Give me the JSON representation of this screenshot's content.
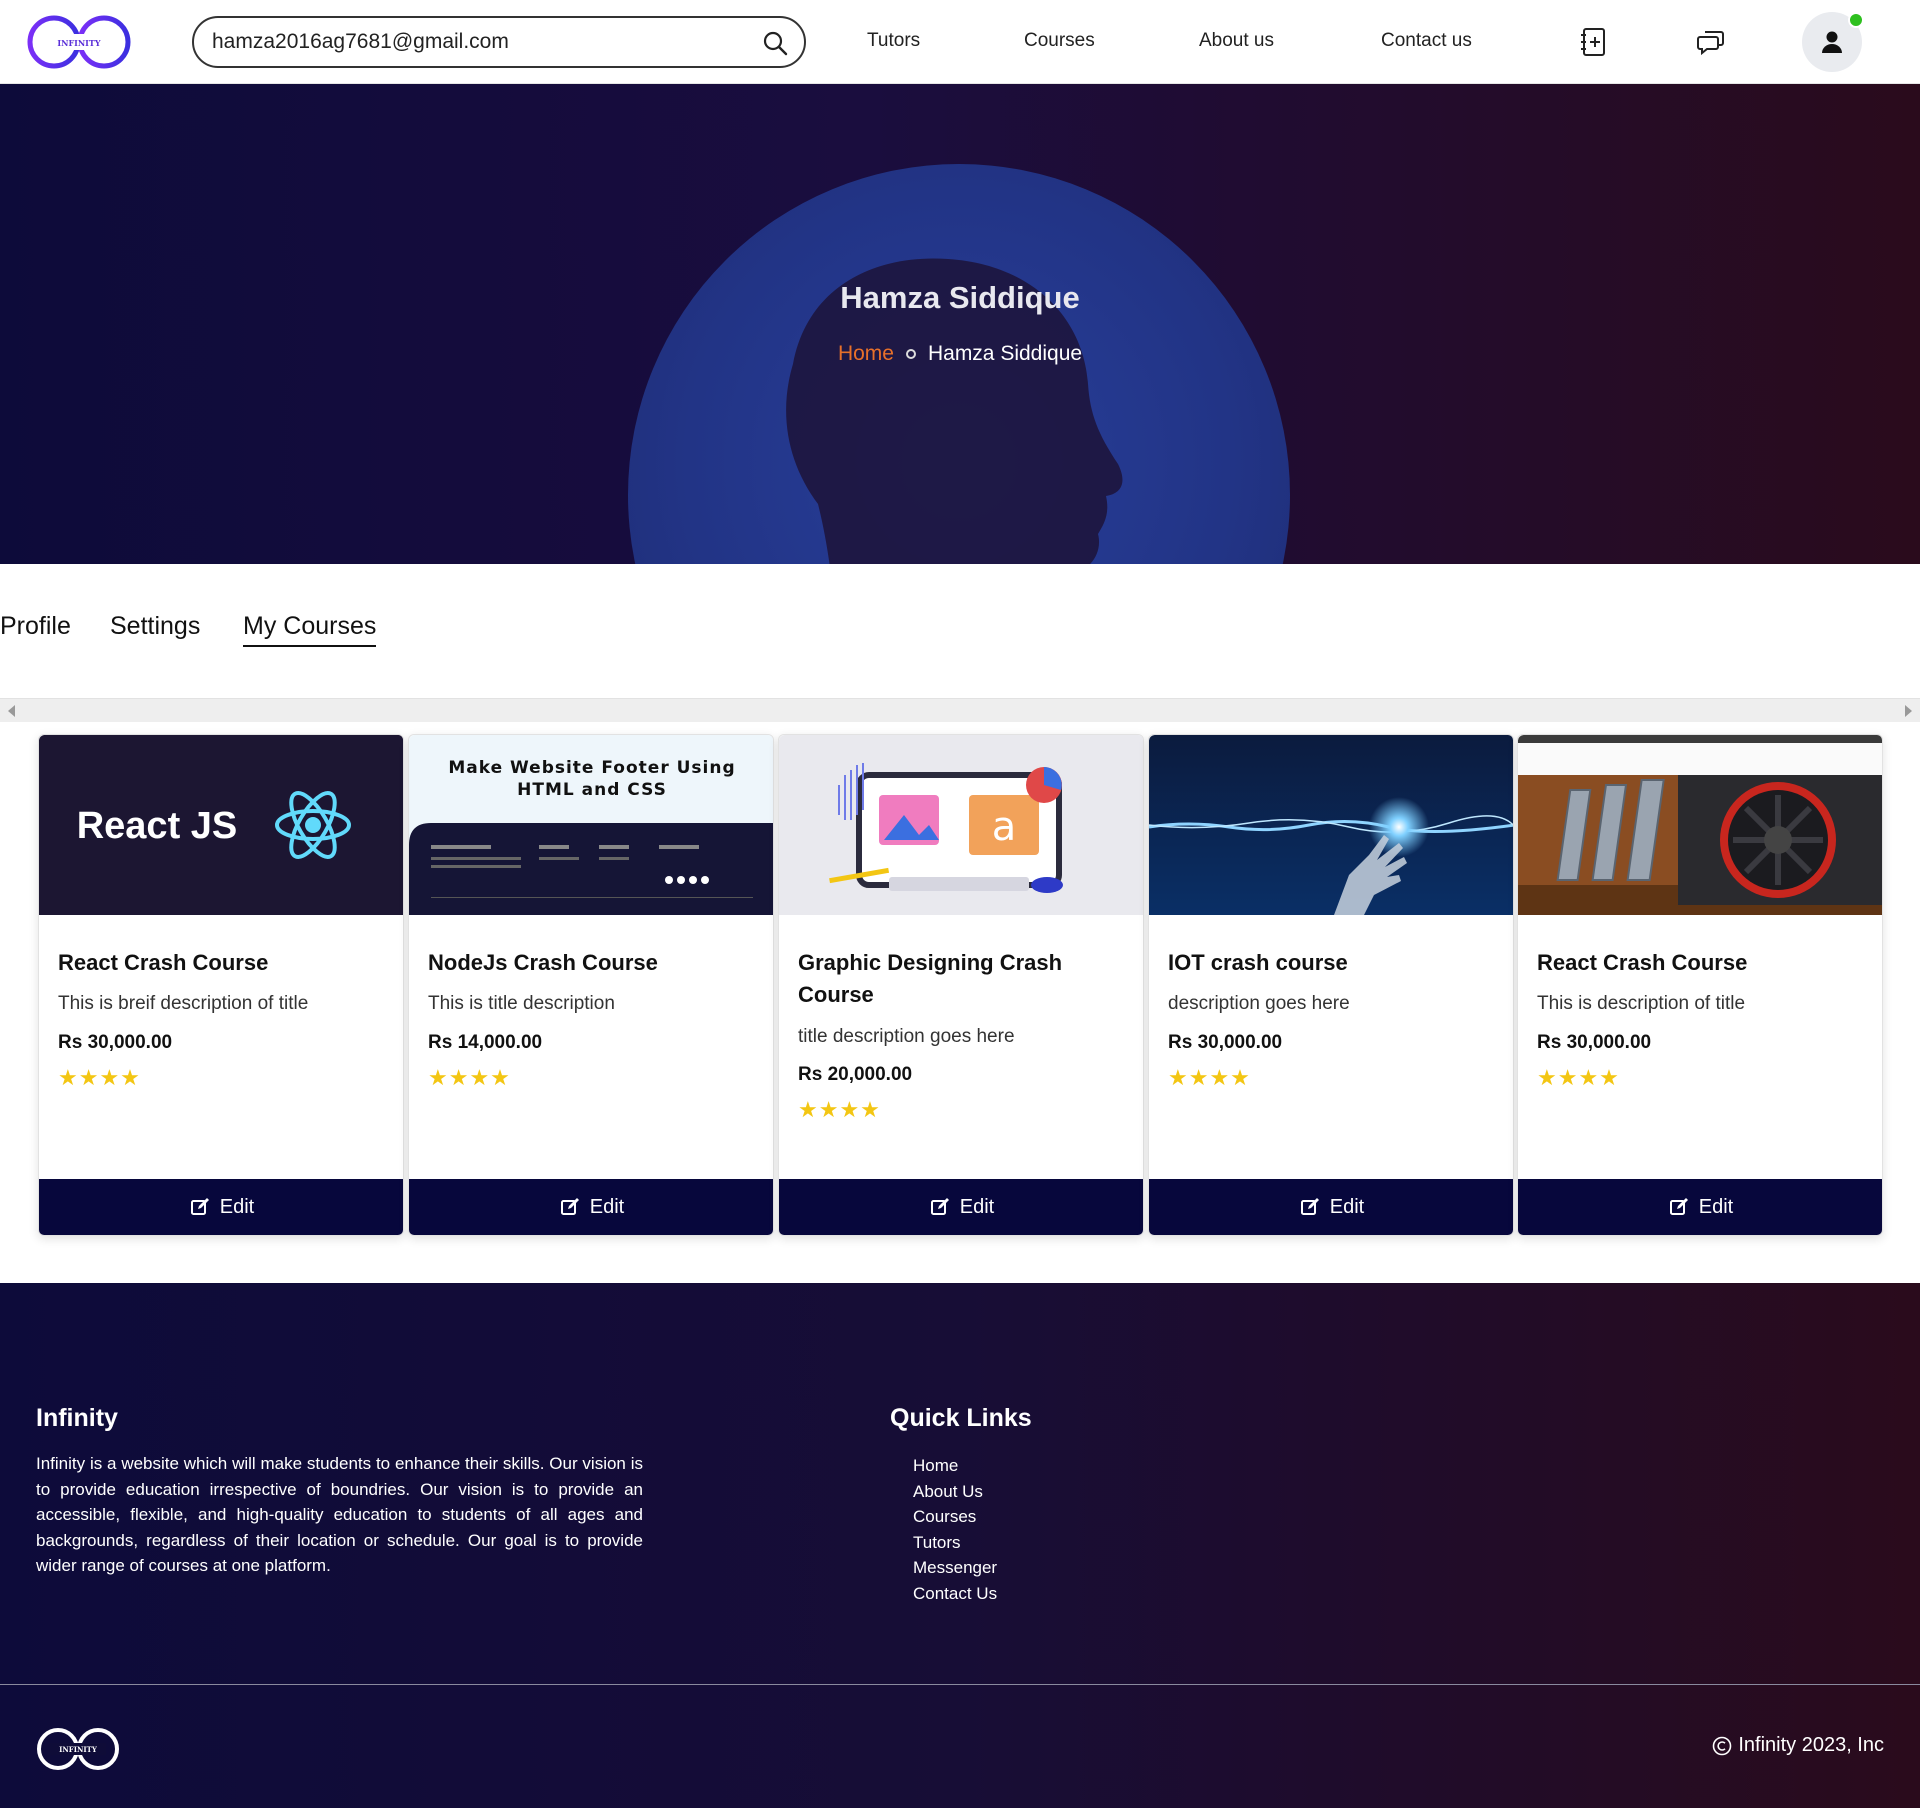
{
  "navbar": {
    "logo_text": "INFINITY",
    "search_value": "hamza2016ag7681@gmail.com",
    "links": [
      "Tutors",
      "Courses",
      "About us",
      "Contact us"
    ]
  },
  "hero": {
    "title": "Hamza Siddique",
    "breadcrumb_home": "Home",
    "breadcrumb_current": "Hamza Siddique"
  },
  "tabs": [
    "Profile",
    "Settings",
    "My Courses"
  ],
  "active_tab": "My Courses",
  "courses": [
    {
      "image_text": "React JS",
      "title": "React Crash Course",
      "description": "This is breif description of title",
      "price": "Rs 30,000.00",
      "rating": 4,
      "stars": "★★★★",
      "edit_label": "Edit"
    },
    {
      "image_text": "Make Website Footer Using HTML and CSS",
      "title": "NodeJs Crash Course",
      "description": "This is title description",
      "price": "Rs 14,000.00",
      "rating": 4,
      "stars": "★★★★",
      "edit_label": "Edit"
    },
    {
      "title": "Graphic Designing Crash Course",
      "description": "title description goes here",
      "price": "Rs 20,000.00",
      "rating": 4,
      "stars": "★★★★",
      "edit_label": "Edit"
    },
    {
      "title": "IOT crash course",
      "description": "description goes here",
      "price": "Rs 30,000.00",
      "rating": 4,
      "stars": "★★★★",
      "edit_label": "Edit"
    },
    {
      "title": "React Crash Course",
      "description": "This is description of title",
      "price": "Rs 30,000.00",
      "rating": 4,
      "stars": "★★★★",
      "edit_label": "Edit"
    }
  ],
  "footer": {
    "brand_title": "Infinity",
    "description": "Infinity is a website which will make students to enhance their skills. Our vision is to provide education irrespective of boundries. Our vision is to provide an accessible, flexible, and high-quality education to students of all ages and backgrounds, regardless of their location or schedule. Our goal is to provide wider range of courses at one platform.",
    "quick_links_title": "Quick Links",
    "quick_links": [
      "Home",
      "About Us",
      "Courses",
      "Tutors",
      "Messenger",
      "Contact Us"
    ],
    "logo_text": "INFINITY",
    "copyright": "Infinity 2023, Inc"
  },
  "colors": {
    "accent_home": "#e8702a",
    "button_bg": "#07073c",
    "star": "#f3c613",
    "online": "#2ec01f"
  }
}
